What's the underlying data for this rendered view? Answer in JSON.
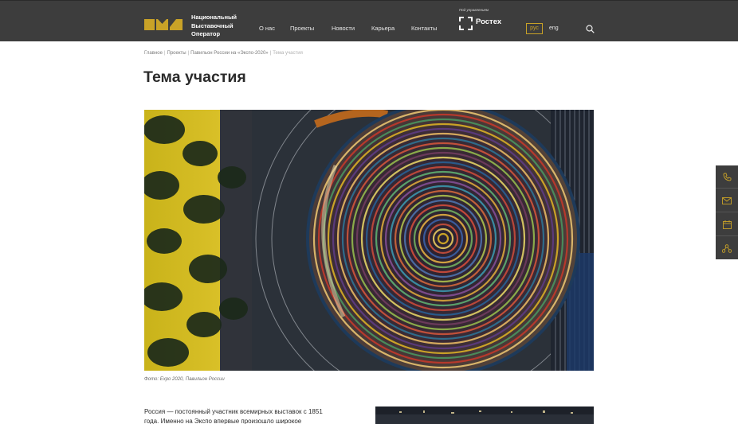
{
  "header": {
    "logo_lines": [
      "Национальный",
      "Выставочный",
      "Оператор"
    ],
    "nav": [
      {
        "label": "О нас"
      },
      {
        "label": "Проекты"
      },
      {
        "label": "Новости"
      },
      {
        "label": "Карьера"
      },
      {
        "label": "Контакты"
      }
    ],
    "rostec_caption": "Под управлением",
    "rostec_name": "Ростех",
    "lang_active": "рус",
    "lang_other": "eng",
    "brand_color": "#c9a227",
    "bg_color": "#3d3d3d"
  },
  "breadcrumb": {
    "items": [
      "Главное",
      "Проекты",
      "Павильон России на «Экспо-2020»"
    ],
    "current": "Тема участия"
  },
  "page_title": "Тема участия",
  "hero_caption": "Фото: Expo 2020, Павильон России",
  "body_text": {
    "lines": [
      "Россия — постоянный участник всемирных выставок с 1851",
      "года. Именно на Экспо впервые произошло широкое"
    ]
  },
  "sidebar": {
    "icons": [
      "phone-icon",
      "mail-icon",
      "calendar-icon",
      "network-icon"
    ]
  }
}
